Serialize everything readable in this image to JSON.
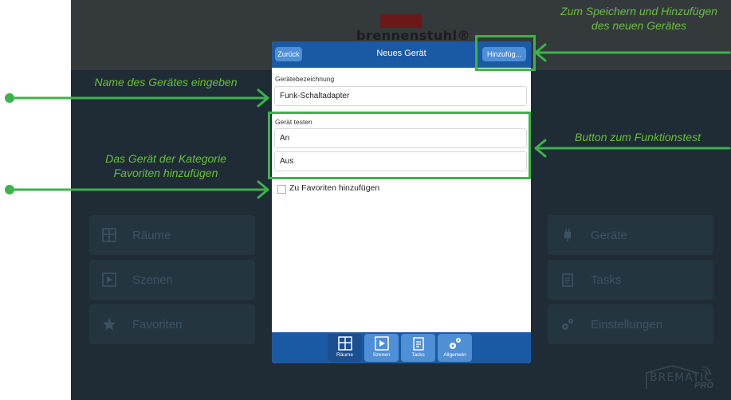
{
  "background_app": {
    "brand": "brennenstuhl®",
    "tiles_left": [
      {
        "label": "Räume",
        "icon": "rooms-icon"
      },
      {
        "label": "Szenen",
        "icon": "play-icon"
      },
      {
        "label": "Favoriten",
        "icon": "star-icon"
      }
    ],
    "tiles_right": [
      {
        "label": "Geräte",
        "icon": "plug-icon"
      },
      {
        "label": "Tasks",
        "icon": "clipboard-icon"
      },
      {
        "label": "Einstellungen",
        "icon": "gears-icon"
      }
    ],
    "footer_logo": {
      "name": "BREMATIC",
      "suffix": "PRO"
    }
  },
  "dialog": {
    "back_label": "Zurück",
    "title": "Neues Gerät",
    "add_label": "Hinzufüg...",
    "name_label": "Gerätebezeichnung",
    "name_value": "Funk-Schaltadapter",
    "test_label": "Gerät testen",
    "test_on": "An",
    "test_off": "Aus",
    "favorite_label": "Zu Favoriten hinzufügen",
    "favorite_checked": false,
    "tabs": [
      {
        "label": "Räume",
        "icon": "rooms-icon"
      },
      {
        "label": "Szenen",
        "icon": "play-icon"
      },
      {
        "label": "Tasks",
        "icon": "clipboard-icon"
      },
      {
        "label": "Allgemein",
        "icon": "gears-icon"
      }
    ]
  },
  "annotations": {
    "name_hint": "Name des Gerätes eingeben",
    "favorite_hint_line1": "Das Gerät der Kategorie",
    "favorite_hint_line2": "Favoriten hinzufügen",
    "save_hint_line1": "Zum Speichern und Hinzufügen",
    "save_hint_line2": "des neuen Gerätes",
    "test_hint": "Button zum Funktionstest"
  },
  "colors": {
    "app_background": "#1f2c36",
    "header_blue": "#1a5aa5",
    "button_blue": "#4e8fd6",
    "annotation_green": "#6abf3c",
    "highlight_green": "#3bb34a"
  }
}
